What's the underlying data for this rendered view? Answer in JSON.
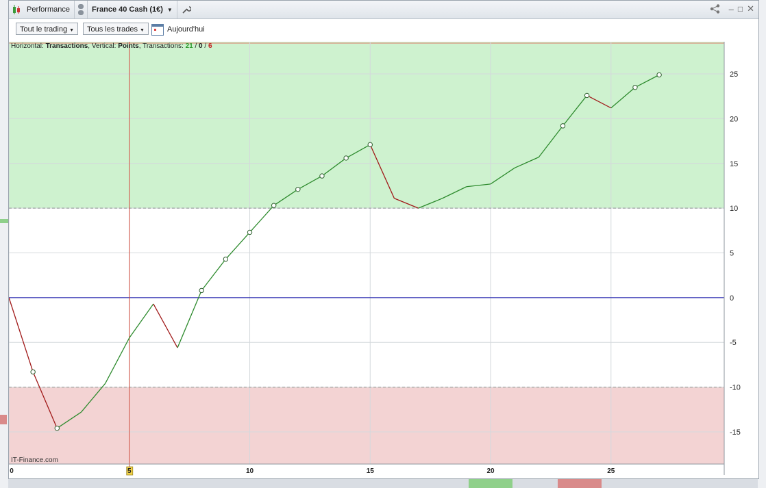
{
  "window": {
    "app_tab": "Performance",
    "instrument": "France 40 Cash (1€)"
  },
  "toolbar": {
    "trading_filter": "Tout le trading",
    "trades_filter": "Tous les trades",
    "today_label": "Aujourd'hui"
  },
  "chart_info": {
    "prefix": "Horizontal: ",
    "horizontal": "Transactions",
    "sep1": ", Vertical: ",
    "vertical": "Points",
    "sep2": ", Transactions: ",
    "wins": "21",
    "slash1": " / ",
    "neutral": "0",
    "slash2": " / ",
    "losses": "6"
  },
  "watermark": "IT-Finance.com",
  "colors": {
    "gain_zone": "#cef2cf",
    "loss_zone": "#f3d3d3",
    "up_line": "#2e8b2e",
    "down_line": "#a01818",
    "zero_line": "#2b2bb0",
    "cursor_line": "#d44a3a"
  },
  "chart_data": {
    "type": "line",
    "xlabel": "",
    "ylabel": "",
    "xlim": [
      0,
      29.7
    ],
    "ylim": [
      -18.6,
      28.6
    ],
    "x_ticks": [
      0,
      5,
      10,
      15,
      20,
      25
    ],
    "y_ticks": [
      25,
      20,
      15,
      10,
      5,
      0,
      -5,
      -10,
      -15
    ],
    "gain_threshold": 10,
    "loss_threshold": -10,
    "highlighted_x": 5,
    "series": [
      {
        "x": [
          0,
          1,
          2,
          3,
          4,
          5,
          6,
          7,
          8,
          9,
          10,
          11,
          12,
          13,
          14,
          15,
          16,
          17,
          18,
          19,
          20,
          21,
          22,
          23,
          24,
          25,
          26,
          27
        ],
        "y": [
          0,
          -8.3,
          -14.6,
          -12.8,
          -9.6,
          -4.5,
          -0.7,
          -5.6,
          0.8,
          4.3,
          7.3,
          10.3,
          12.1,
          13.6,
          15.6,
          17.1,
          11.1,
          10,
          11.1,
          12.4,
          12.7,
          14.5,
          15.7,
          19.2,
          22.6,
          21.2,
          23.5,
          24.9
        ]
      }
    ]
  }
}
